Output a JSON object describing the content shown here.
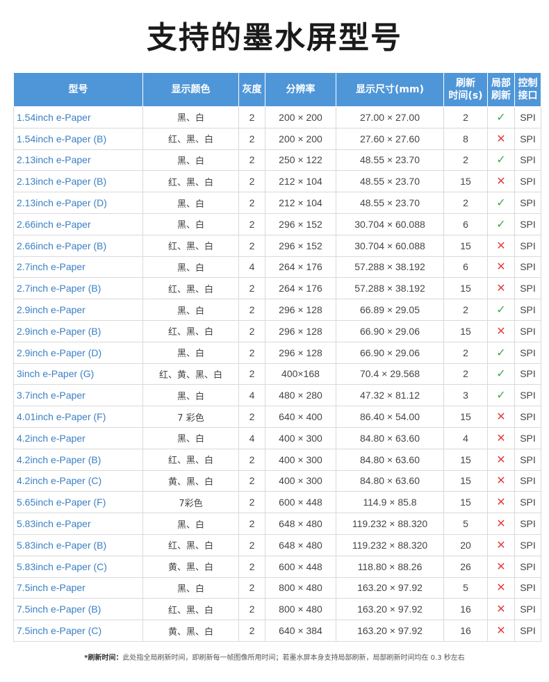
{
  "title": "支持的墨水屏型号",
  "table": {
    "headers": {
      "model": "型号",
      "color": "显示颜色",
      "gray": "灰度",
      "resolution": "分辨率",
      "size": "显示尺寸(mm)",
      "refresh_1": "刷新",
      "refresh_2": "时间(s)",
      "partial_1": "局部",
      "partial_2": "刷新",
      "iface_1": "控制",
      "iface_2": "接口"
    },
    "rows": [
      {
        "model": "1.54inch e-Paper",
        "color": "黑、白",
        "gray": "2",
        "resolution": "200 × 200",
        "size": "27.00 × 27.00",
        "refresh": "2",
        "partial": "✓",
        "iface": "SPI"
      },
      {
        "model": "1.54inch e-Paper (B)",
        "color": "红、黑、白",
        "gray": "2",
        "resolution": "200 × 200",
        "size": "27.60 × 27.60",
        "refresh": "8",
        "partial": "✕",
        "iface": "SPI"
      },
      {
        "model": "2.13inch e-Paper",
        "color": "黑、白",
        "gray": "2",
        "resolution": "250 × 122",
        "size": "48.55 × 23.70",
        "refresh": "2",
        "partial": "✓",
        "iface": "SPI"
      },
      {
        "model": "2.13inch e-Paper (B)",
        "color": "红、黑、白",
        "gray": "2",
        "resolution": "212 × 104",
        "size": "48.55 × 23.70",
        "refresh": "15",
        "partial": "✕",
        "iface": "SPI"
      },
      {
        "model": "2.13inch e-Paper (D)",
        "color": "黑、白",
        "gray": "2",
        "resolution": "212 × 104",
        "size": "48.55 × 23.70",
        "refresh": "2",
        "partial": "✓",
        "iface": "SPI"
      },
      {
        "model": "2.66inch e-Paper",
        "color": "黑、白",
        "gray": "2",
        "resolution": "296 × 152",
        "size": "30.704 × 60.088",
        "refresh": "6",
        "partial": "✓",
        "iface": "SPI"
      },
      {
        "model": "2.66inch e-Paper (B)",
        "color": "红、黑、白",
        "gray": "2",
        "resolution": "296 × 152",
        "size": "30.704 × 60.088",
        "refresh": "15",
        "partial": "✕",
        "iface": "SPI"
      },
      {
        "model": "2.7inch e-Paper",
        "color": "黑、白",
        "gray": "4",
        "resolution": "264 × 176",
        "size": "57.288 × 38.192",
        "refresh": "6",
        "partial": "✕",
        "iface": "SPI"
      },
      {
        "model": "2.7inch e-Paper (B)",
        "color": "红、黑、白",
        "gray": "2",
        "resolution": "264 × 176",
        "size": "57.288 × 38.192",
        "refresh": "15",
        "partial": "✕",
        "iface": "SPI"
      },
      {
        "model": "2.9inch e-Paper",
        "color": "黑、白",
        "gray": "2",
        "resolution": "296 × 128",
        "size": "66.89 × 29.05",
        "refresh": "2",
        "partial": "✓",
        "iface": "SPI"
      },
      {
        "model": "2.9inch e-Paper (B)",
        "color": "红、黑、白",
        "gray": "2",
        "resolution": "296 × 128",
        "size": "66.90 × 29.06",
        "refresh": "15",
        "partial": "✕",
        "iface": "SPI"
      },
      {
        "model": "2.9inch e-Paper (D)",
        "color": "黑、白",
        "gray": "2",
        "resolution": "296 × 128",
        "size": "66.90 × 29.06",
        "refresh": "2",
        "partial": "✓",
        "iface": "SPI"
      },
      {
        "model": "3inch e-Paper (G)",
        "color": "红、黄、黑、白",
        "gray": "2",
        "resolution": "400×168",
        "size": "70.4 × 29.568",
        "refresh": "2",
        "partial": "✓",
        "iface": "SPI"
      },
      {
        "model": "3.7inch e-Paper",
        "color": "黑、白",
        "gray": "4",
        "resolution": "480 × 280",
        "size": "47.32 × 81.12",
        "refresh": "3",
        "partial": "✓",
        "iface": "SPI"
      },
      {
        "model": "4.01inch e-Paper (F)",
        "color": "7 彩色",
        "gray": "2",
        "resolution": "640 × 400",
        "size": "86.40 × 54.00",
        "refresh": "15",
        "partial": "✕",
        "iface": "SPI"
      },
      {
        "model": "4.2inch e-Paper",
        "color": "黑、白",
        "gray": "4",
        "resolution": "400 × 300",
        "size": "84.80 × 63.60",
        "refresh": "4",
        "partial": "✕",
        "iface": "SPI"
      },
      {
        "model": "4.2inch e-Paper (B)",
        "color": "红、黑、白",
        "gray": "2",
        "resolution": "400 × 300",
        "size": "84.80 × 63.60",
        "refresh": "15",
        "partial": "✕",
        "iface": "SPI"
      },
      {
        "model": "4.2inch e-Paper (C)",
        "color": "黄、黑、白",
        "gray": "2",
        "resolution": "400 × 300",
        "size": "84.80 × 63.60",
        "refresh": "15",
        "partial": "✕",
        "iface": "SPI"
      },
      {
        "model": "5.65inch e-Paper (F)",
        "color": "7彩色",
        "gray": "2",
        "resolution": "600 × 448",
        "size": "114.9 × 85.8",
        "refresh": "15",
        "partial": "✕",
        "iface": "SPI"
      },
      {
        "model": "5.83inch e-Paper",
        "color": "黑、白",
        "gray": "2",
        "resolution": "648 × 480",
        "size": "119.232 × 88.320",
        "refresh": "5",
        "partial": "✕",
        "iface": "SPI"
      },
      {
        "model": "5.83inch e-Paper (B)",
        "color": "红、黑、白",
        "gray": "2",
        "resolution": "648 × 480",
        "size": "119.232 × 88.320",
        "refresh": "20",
        "partial": "✕",
        "iface": "SPI"
      },
      {
        "model": "5.83inch e-Paper (C)",
        "color": "黄、黑、白",
        "gray": "2",
        "resolution": "600 × 448",
        "size": "118.80 × 88.26",
        "refresh": "26",
        "partial": "✕",
        "iface": "SPI"
      },
      {
        "model": "7.5inch e-Paper",
        "color": "黑、白",
        "gray": "2",
        "resolution": "800 × 480",
        "size": "163.20 × 97.92",
        "refresh": "5",
        "partial": "✕",
        "iface": "SPI"
      },
      {
        "model": "7.5inch e-Paper (B)",
        "color": "红、黑、白",
        "gray": "2",
        "resolution": "800 × 480",
        "size": "163.20 × 97.92",
        "refresh": "16",
        "partial": "✕",
        "iface": "SPI"
      },
      {
        "model": "7.5inch e-Paper (C)",
        "color": "黄、黑、白",
        "gray": "2",
        "resolution": "640 × 384",
        "size": "163.20 × 97.92",
        "refresh": "16",
        "partial": "✕",
        "iface": "SPI"
      }
    ]
  },
  "footnote": {
    "label": "*刷新时间：",
    "text": "此处指全局刷新时间，即刷新每一帧图像所用时间；若墨水屏本身支持局部刷新，局部刷新时间均在 0.3 秒左右"
  },
  "colors": {
    "header_bg": "#4f96d8",
    "model_text": "#3b7fc4",
    "check": "#3ca84a",
    "cross": "#e43d3d"
  }
}
